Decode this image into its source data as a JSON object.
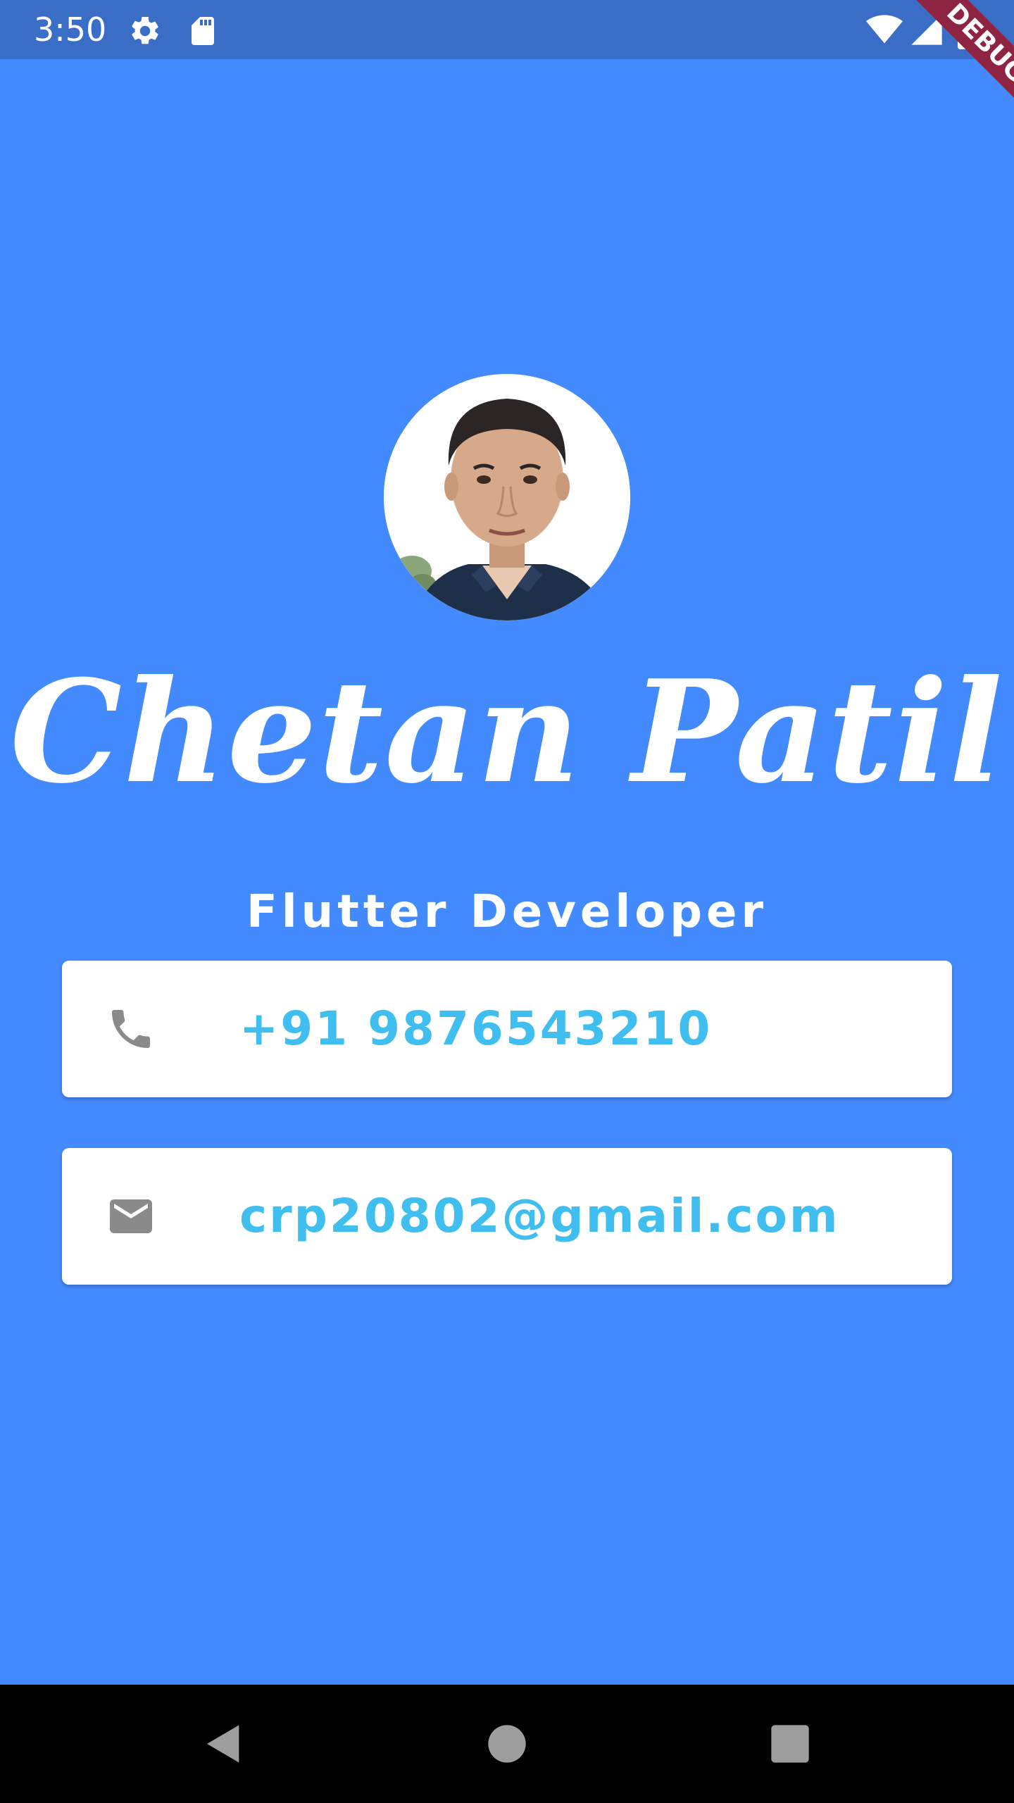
{
  "status_bar": {
    "time": "3:50",
    "background": "#3A6DC5",
    "left_icons": [
      "settings-icon",
      "sd-card-icon"
    ],
    "right_icons": [
      "wifi-icon",
      "signal-icon",
      "battery-icon"
    ]
  },
  "debug_banner": {
    "label": "DEBUG",
    "color": "#8E2342"
  },
  "profile": {
    "avatar": "profile-photo",
    "name": "Chetan Patil",
    "title": "Flutter Developer"
  },
  "contacts": [
    {
      "icon": "phone-icon",
      "value": "+91 9876543210"
    },
    {
      "icon": "mail-icon",
      "value": "crp20802@gmail.com"
    }
  ],
  "nav_bar": {
    "buttons": [
      "back-icon",
      "home-icon",
      "recents-icon"
    ]
  },
  "colors": {
    "background": "#448AFF",
    "card": "#FFFFFF",
    "accent_text": "#40BEF0",
    "icon": "#8A8A8A"
  }
}
